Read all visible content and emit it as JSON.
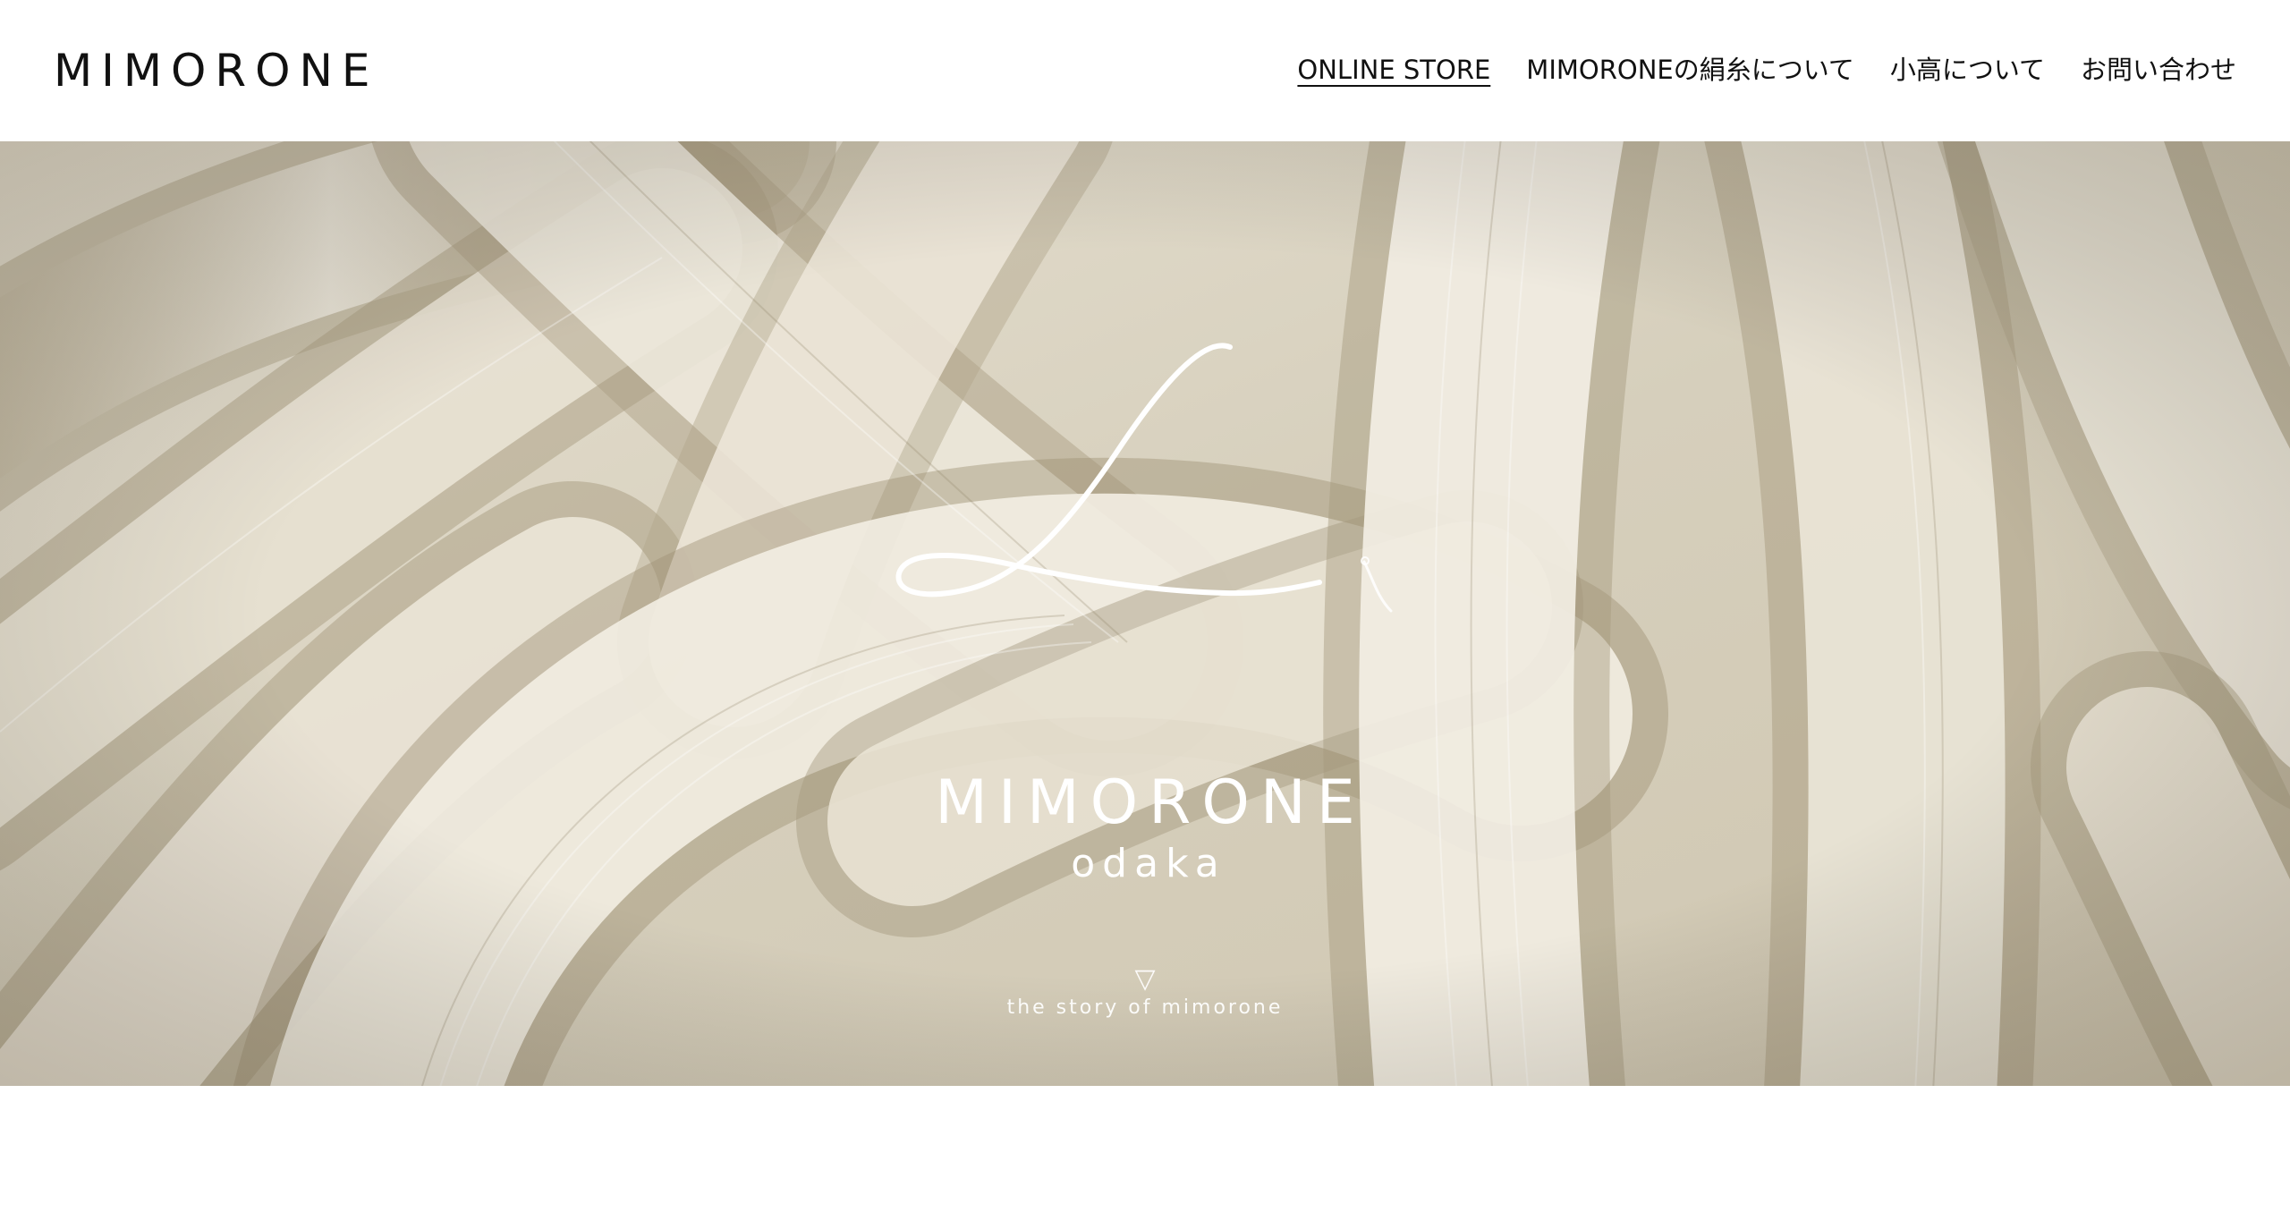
{
  "header": {
    "logo": "MIMORONE",
    "nav": [
      {
        "label": "ONLINE STORE",
        "active": true
      },
      {
        "label": "MIMORONEの絹糸について",
        "active": false
      },
      {
        "label": "小高について",
        "active": false
      },
      {
        "label": "お問い合わせ",
        "active": false
      }
    ]
  },
  "hero": {
    "title": "MIMORONE",
    "subtitle": "odaka",
    "scroll_arrow": "▽",
    "scroll_text": "the story of mimorone",
    "mark_icon": "thread-needle-logo-icon",
    "background": "silk-thread-skeins-photo",
    "colors": {
      "silk_base": "#d8d1bf",
      "silk_light": "#f1ece0",
      "silk_shadow": "#a69a80",
      "overlay_text": "#ffffff"
    }
  }
}
